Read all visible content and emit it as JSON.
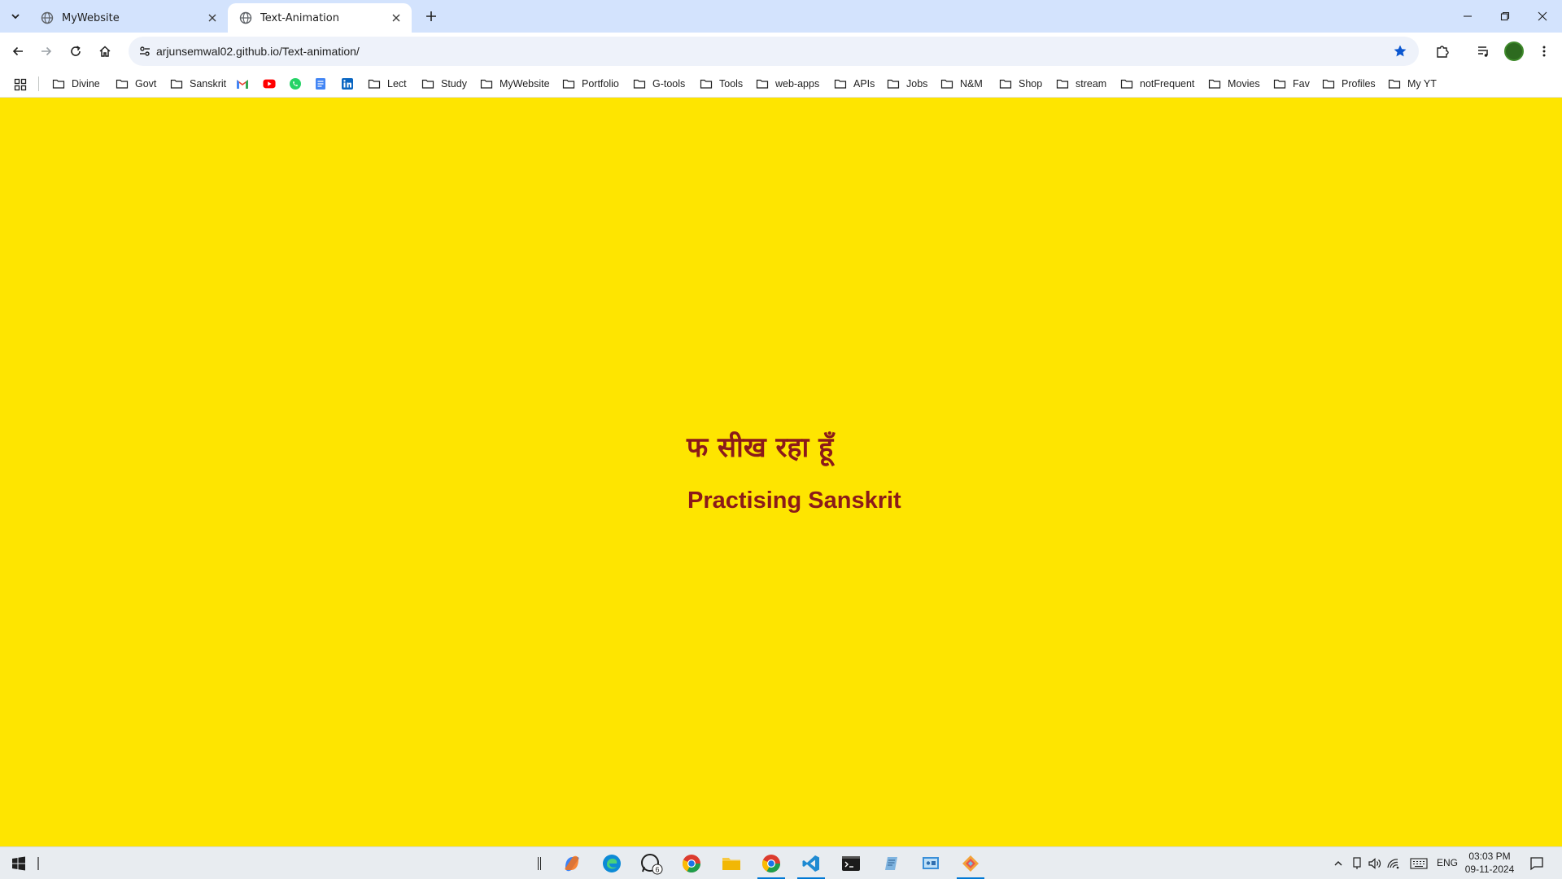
{
  "browser": {
    "tabs": [
      {
        "title": "MyWebsite",
        "active": false
      },
      {
        "title": "Text-Animation",
        "active": true
      }
    ],
    "url": "arjunsemwal02.github.io/Text-animation/",
    "bookmarked": true,
    "bookmarks": [
      {
        "label": "Divine",
        "icon": "folder-icon"
      },
      {
        "label": "Govt",
        "icon": "folder-icon"
      },
      {
        "label": "Sanskrit",
        "icon": "folder-icon"
      },
      {
        "label": "",
        "icon": "gmail-icon"
      },
      {
        "label": "",
        "icon": "youtube-icon"
      },
      {
        "label": "",
        "icon": "whatsapp-icon"
      },
      {
        "label": "",
        "icon": "docs-icon"
      },
      {
        "label": "",
        "icon": "linkedin-icon"
      },
      {
        "label": "Lect",
        "icon": "folder-icon"
      },
      {
        "label": "Study",
        "icon": "folder-icon"
      },
      {
        "label": "MyWebsite",
        "icon": "folder-icon"
      },
      {
        "label": "Portfolio",
        "icon": "folder-icon"
      },
      {
        "label": "G-tools",
        "icon": "folder-icon"
      },
      {
        "label": "Tools",
        "icon": "folder-icon"
      },
      {
        "label": "web-apps",
        "icon": "folder-icon"
      },
      {
        "label": "APIs",
        "icon": "folder-icon"
      },
      {
        "label": "Jobs",
        "icon": "folder-icon"
      },
      {
        "label": "N&M",
        "icon": "folder-icon"
      },
      {
        "label": "Shop",
        "icon": "folder-icon"
      },
      {
        "label": "stream",
        "icon": "folder-icon"
      },
      {
        "label": "notFrequent",
        "icon": "folder-icon"
      },
      {
        "label": "Movies",
        "icon": "folder-icon"
      },
      {
        "label": "Fav",
        "icon": "folder-icon"
      },
      {
        "label": "Profiles",
        "icon": "folder-icon"
      },
      {
        "label": "My YT",
        "icon": "folder-icon"
      }
    ]
  },
  "page": {
    "background": "#fee500",
    "text_color": "#8b1a1a",
    "hindi_line": "फ सीख रहा हूँ",
    "english_line": "Practising Sanskrit"
  },
  "taskbar": {
    "apps": [
      "copilot-icon",
      "edge-icon",
      "whatsapp-icon",
      "chrome-icon",
      "file-explorer-icon",
      "chrome-active-icon",
      "vscode-icon",
      "terminal-icon",
      "notepad-icon",
      "control-panel-icon",
      "app-icon"
    ],
    "whatsapp_badge": "6",
    "language": "ENG",
    "time": "03:03 PM",
    "date": "09-11-2024"
  }
}
